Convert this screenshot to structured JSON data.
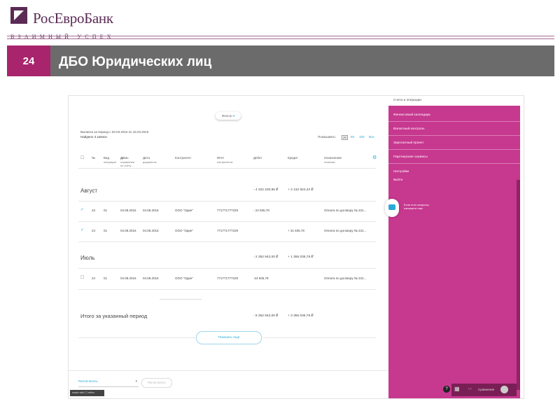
{
  "slide": {
    "brand": "РосЕвроБанк",
    "tagline": "ВЗАИМНЫЙ УСПЕХ",
    "page_number": "24",
    "title": "ДБО Юридических лиц"
  },
  "app": {
    "filter_label": "Фильтр",
    "period_text": "Выписка за период с 03.03.2016 по 15.03.2016",
    "found_text": "Найдено 3 записи",
    "show_label": "Показывать:",
    "page_sizes": [
      "20",
      "50",
      "100",
      "Все"
    ],
    "columns": [
      "№",
      "Вид",
      "Дата",
      "Дата",
      "Контрагент",
      "ИНН",
      "Дебет",
      "Кредит",
      "Назначение"
    ],
    "column_subs": [
      "",
      "операции",
      "отражения по счету",
      "документа",
      "",
      "контрагента",
      "",
      "",
      "платежа"
    ],
    "groups": [
      {
        "month": "Август",
        "debit": "- 4 322 230,95 ₽",
        "credit": "+ 2 132 924,34 ₽",
        "rows": [
          {
            "check": "✓",
            "num": "23",
            "type": "01",
            "date1": "04.08.2016",
            "date2": "04.08.2016",
            "contragent": "ООО \"Один\"",
            "inn": "771771777229",
            "debit": "- 24 935,78",
            "credit": "",
            "purpose": "Оплата по договору № 231..."
          },
          {
            "check": "✓",
            "num": "24",
            "type": "01",
            "date1": "04.08.2016",
            "date2": "04.08.2016",
            "contragent": "ООО \"Один\"",
            "inn": "771771777229",
            "debit": "",
            "credit": "+ 31 935,78",
            "purpose": "Оплата по договору № 231..."
          }
        ]
      },
      {
        "month": "Июль",
        "debit": "- 2 352 942,00 ₽",
        "credit": "+ 1 355 035,78 ₽",
        "rows": [
          {
            "check": "☐",
            "num": "24",
            "type": "01",
            "date1": "04.08.2016",
            "date2": "04.08.2016",
            "contragent": "ООО \"Один\"",
            "inn": "771771777229",
            "debit": "-24 935,78",
            "credit": "",
            "purpose": "Оплата по договору № 231..."
          }
        ]
      }
    ],
    "total_label": "Итого за указанный период",
    "total_debit": "- 6 352 942,00 ₽",
    "total_credit": "+ 3 355 035,78 ₽",
    "show_more": "Показать еще",
    "print_select": "Распечатать",
    "print_button": "Распечатать",
    "watermark": "made with ☐ reflex"
  },
  "panel": {
    "top": "Счета и операции",
    "items": [
      "Финансовый календарь",
      "Валютный контроль",
      "Зарплатный проект",
      "Партнерские сервисы"
    ],
    "links": [
      "Настройки",
      "Выйти"
    ],
    "chat_text": "Если есть вопросы, напишите нам",
    "bottom_label": "Сравнение"
  },
  "colors": {
    "brand": "#5b2a55",
    "accent": "#a8246d",
    "panel": "#c7388f",
    "link": "#2aa9d6",
    "bar": "#6b6b6b"
  }
}
